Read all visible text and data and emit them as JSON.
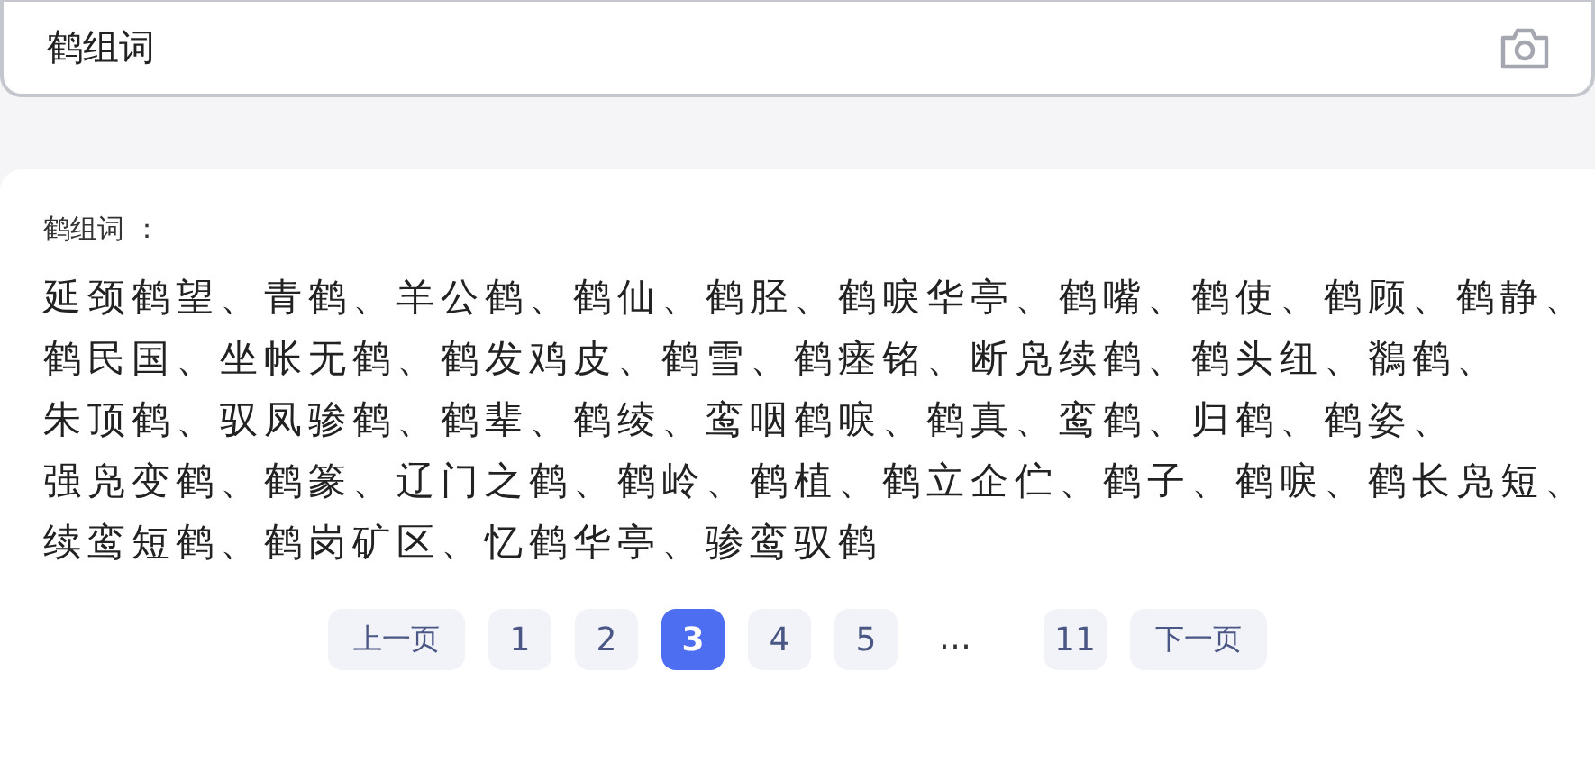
{
  "search": {
    "value": "鹤组词"
  },
  "result": {
    "heading": "鹤组词 ：",
    "lines": [
      "延颈鹤望、青鹤、羊公鹤、鹤仙、鹤胫、鹤唳华亭、鹤嘴、鹤使、鹤顾、鹤静、",
      "鹤民国、坐帐无鹤、鹤发鸡皮、鹤雪、鹤瘗铭、断凫续鹤、鹤头纽、鶺鹤、",
      "朱顶鹤、驭凤骖鹤、鹤辈、鹤绫、鸾咽鹤唳、鹤真、鸾鹤、归鹤、鹤姿、",
      "强凫变鹤、鹤篆、辽门之鹤、鹤岭、鹤植、鹤立企伫、鹤子、鹤唳、鹤长凫短、",
      "续鸾短鹤、鹤岗矿区、忆鹤华亭、骖鸾驭鹤"
    ]
  },
  "pagination": [
    {
      "kind": "prev",
      "label": "上一页"
    },
    {
      "kind": "page",
      "label": "1",
      "selected": false
    },
    {
      "kind": "page",
      "label": "2",
      "selected": false
    },
    {
      "kind": "page",
      "label": "3",
      "selected": true
    },
    {
      "kind": "page",
      "label": "4",
      "selected": false
    },
    {
      "kind": "page",
      "label": "5",
      "selected": false
    },
    {
      "kind": "ellipsis",
      "label": "…"
    },
    {
      "kind": "page",
      "label": "11",
      "selected": false
    },
    {
      "kind": "next",
      "label": "下一页"
    }
  ]
}
